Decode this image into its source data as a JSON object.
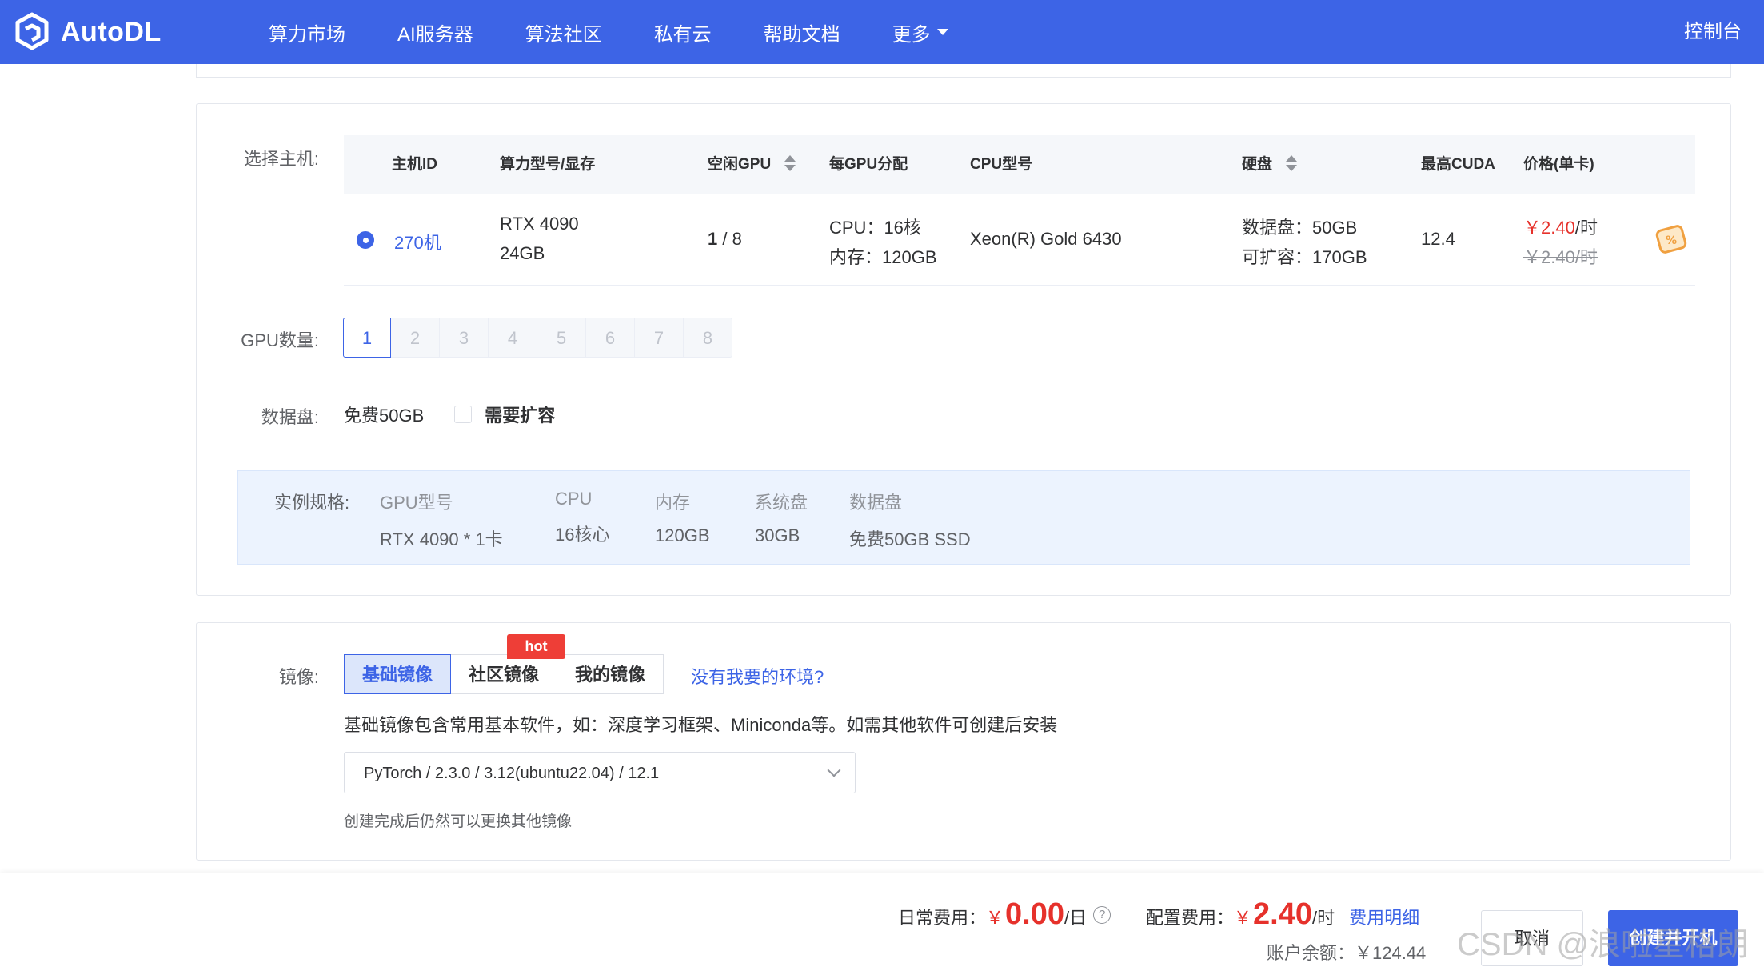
{
  "brand": {
    "name": "AutoDL",
    "color": "#3d64e6"
  },
  "nav": {
    "items": [
      "算力市场",
      "AI服务器",
      "算法社区",
      "私有云",
      "帮助文档",
      "更多"
    ],
    "console": "控制台"
  },
  "host": {
    "label": "选择主机:",
    "headers": {
      "host_id": "主机ID",
      "gpu_model": "算力型号/显存",
      "free_gpu": "空闲GPU",
      "per_gpu": "每GPU分配",
      "cpu_model": "CPU型号",
      "disk": "硬盘",
      "cuda": "最高CUDA",
      "price": "价格(单卡)"
    },
    "row": {
      "selected": true,
      "host_id": "270机",
      "gpu_model": "RTX 4090",
      "gpu_mem": "24GB",
      "free_gpu_a": "1",
      "free_gpu_b": "/ 8",
      "cpu_alloc": "CPU：16核",
      "mem_alloc": "内存：120GB",
      "cpu_model": "Xeon(R) Gold 6430",
      "data_disk": "数据盘：50GB",
      "expandable": "可扩容：170GB",
      "cuda": "12.4",
      "price": "￥2.40",
      "price_unit": "/时",
      "orig_price": "￥2.40/时",
      "discount_icon": "discount-tag-icon"
    }
  },
  "gpu_count": {
    "label": "GPU数量:",
    "options": [
      "1",
      "2",
      "3",
      "4",
      "5",
      "6",
      "7",
      "8"
    ],
    "selected": "1"
  },
  "data_disk": {
    "label": "数据盘:",
    "free": "免费50GB",
    "expand_label": "需要扩容",
    "expand_checked": false
  },
  "spec": {
    "label": "实例规格:",
    "gpu_k": "GPU型号",
    "gpu_v": "RTX 4090 * 1卡",
    "cpu_k": "CPU",
    "cpu_v": "16核心",
    "mem_k": "内存",
    "mem_v": "120GB",
    "sys_k": "系统盘",
    "sys_v": "30GB",
    "data_k": "数据盘",
    "data_v": "免费50GB SSD"
  },
  "image": {
    "label": "镜像:",
    "tabs": [
      "基础镜像",
      "社区镜像",
      "我的镜像"
    ],
    "active_tab": "基础镜像",
    "hot_badge": "hot",
    "no_env_link": "没有我要的环境?",
    "description": "基础镜像包含常用基本软件，如：深度学习框架、Miniconda等。如需其他软件可创建后安装",
    "selected": "PyTorch / 2.3.0 / 3.12(ubuntu22.04) / 12.1",
    "hint": "创建完成后仍然可以更换其他镜像"
  },
  "footer": {
    "daily_label": "日常费用：",
    "daily_yen": "￥",
    "daily_value": "0.00",
    "daily_unit": "/日",
    "config_label": "配置费用：",
    "config_yen": "￥",
    "config_value": "2.40",
    "config_unit": "/时",
    "fee_detail": "费用明细",
    "balance": "账户余额：￥124.44",
    "cancel": "取消",
    "create": "创建并开机"
  },
  "watermark": "CSDN @浪啦星格朗"
}
